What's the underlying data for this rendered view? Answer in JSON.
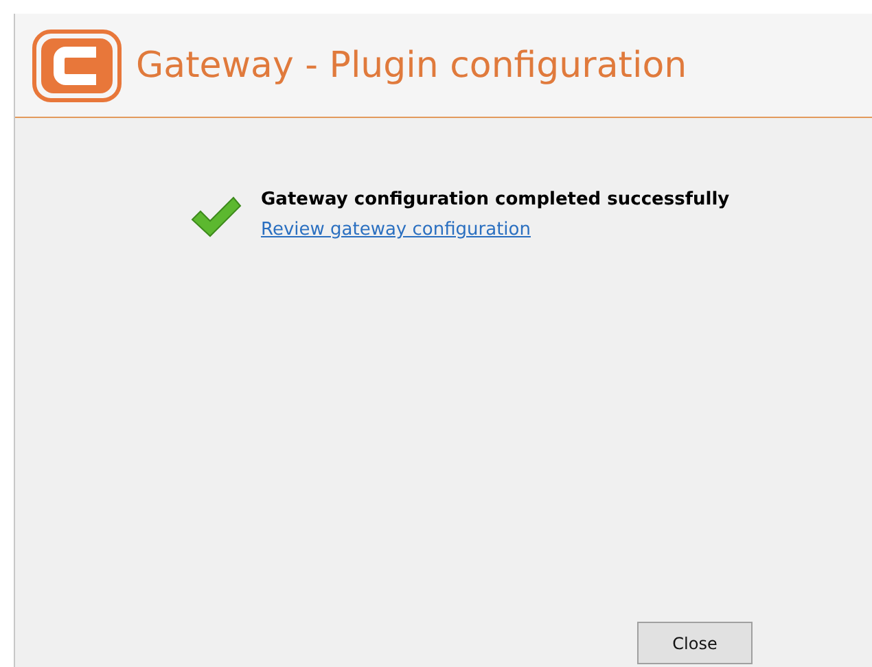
{
  "window": {
    "title": "Gateway - Plugin configuration"
  },
  "message": {
    "text": "Gateway configuration completed successfully",
    "link": "Review gateway configuration"
  },
  "buttons": [
    "Close"
  ]
}
